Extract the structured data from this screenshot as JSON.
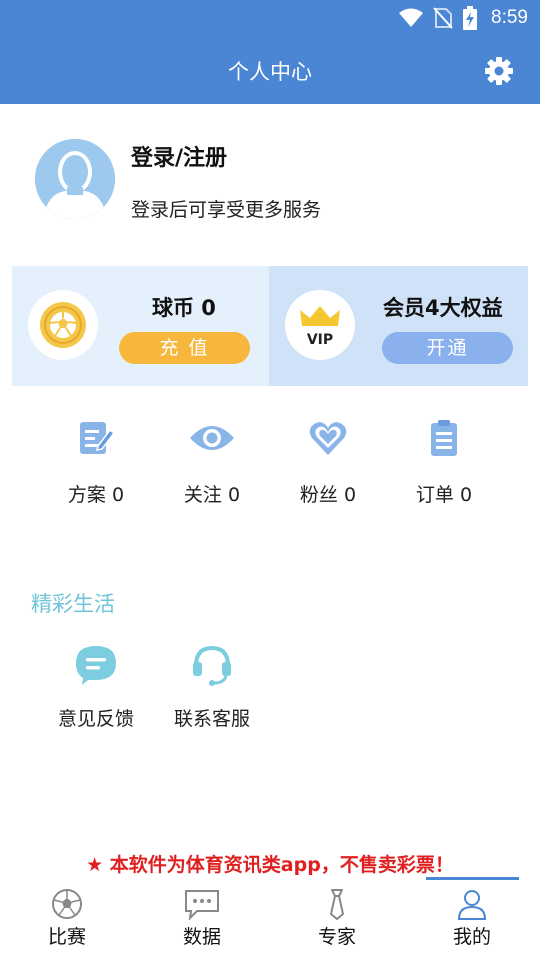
{
  "status_bar": {
    "time": "8:59"
  },
  "header": {
    "title": "个人中心"
  },
  "profile": {
    "title": "登录/注册",
    "subtitle": "登录后可享受更多服务"
  },
  "coin_card": {
    "title": "球币 0",
    "button": "充 值"
  },
  "vip_card": {
    "title": "会员4大权益",
    "button": "开通",
    "logo_text": "VIP"
  },
  "stats": [
    {
      "label": "方案 0",
      "icon": "plan-icon"
    },
    {
      "label": "关注 0",
      "icon": "eye-icon"
    },
    {
      "label": "粉丝 0",
      "icon": "heart-icon"
    },
    {
      "label": "订单 0",
      "icon": "clipboard-icon"
    }
  ],
  "section": {
    "title": "精彩生活"
  },
  "services": [
    {
      "label": "意见反馈",
      "icon": "feedback-icon"
    },
    {
      "label": "联系客服",
      "icon": "headset-icon"
    }
  ],
  "notice": "★ 本软件为体育资讯类app，不售卖彩票！",
  "tabs": [
    {
      "label": "比赛",
      "icon": "soccer-ball-icon"
    },
    {
      "label": "数据",
      "icon": "chat-bubble-icon"
    },
    {
      "label": "专家",
      "icon": "tie-icon"
    },
    {
      "label": "我的",
      "icon": "person-icon",
      "active": true
    }
  ],
  "colors": {
    "primary": "#4a86d4",
    "accent_orange": "#f6b73c",
    "section_teal": "#6fc4d9",
    "notice_red": "#e02020"
  }
}
